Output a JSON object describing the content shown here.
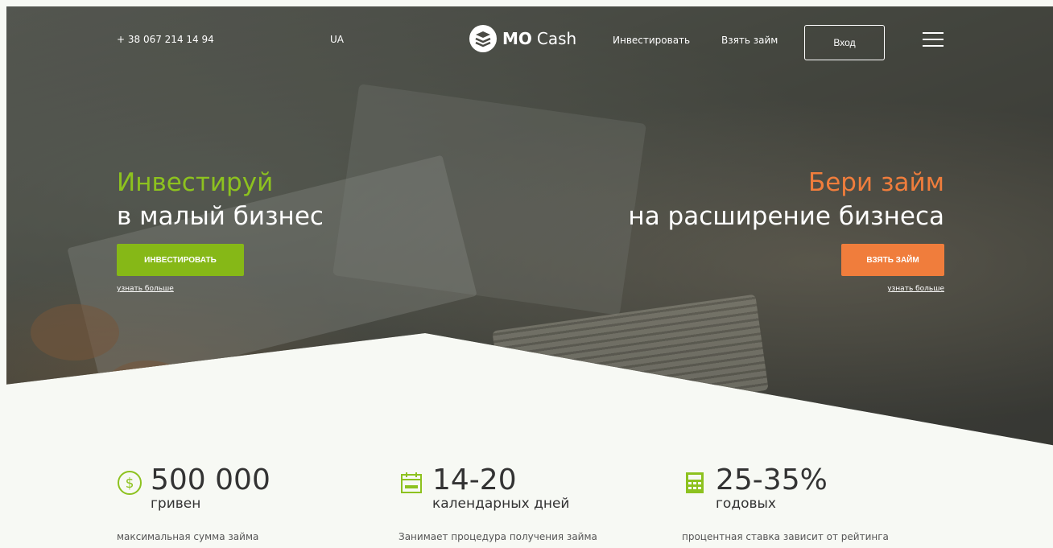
{
  "header": {
    "phone": "+ 38 067 214 14 94",
    "lang": "UA",
    "logo_bold": "MO",
    "logo_light": "Cash",
    "nav": [
      "Инвестировать",
      "Взять займ"
    ],
    "login": "Вход"
  },
  "hero": {
    "left": {
      "accent": "Инвестируй",
      "title": "в малый бизнес",
      "button": "ИНВЕСТИРОВАТЬ",
      "more": "узнать больше"
    },
    "right": {
      "accent": "Бери займ",
      "title": "на расширение бизнеса",
      "button": "ВЗЯТЬ ЗАЙМ",
      "more": "узнать больше"
    }
  },
  "stats": [
    {
      "value": "500 000",
      "unit": "гривен",
      "desc": "максимальная сумма займа",
      "icon": "dollar-circle-icon"
    },
    {
      "value": "14-20",
      "unit": "календарных дней",
      "desc": "Занимает процедура получения займа",
      "icon": "calendar-icon"
    },
    {
      "value": "25-35%",
      "unit": "годовых",
      "desc": "процентная ставка зависит от рейтинга",
      "icon": "calculator-icon"
    }
  ],
  "colors": {
    "green": "#8dc21f",
    "orange": "#f07d3c"
  }
}
